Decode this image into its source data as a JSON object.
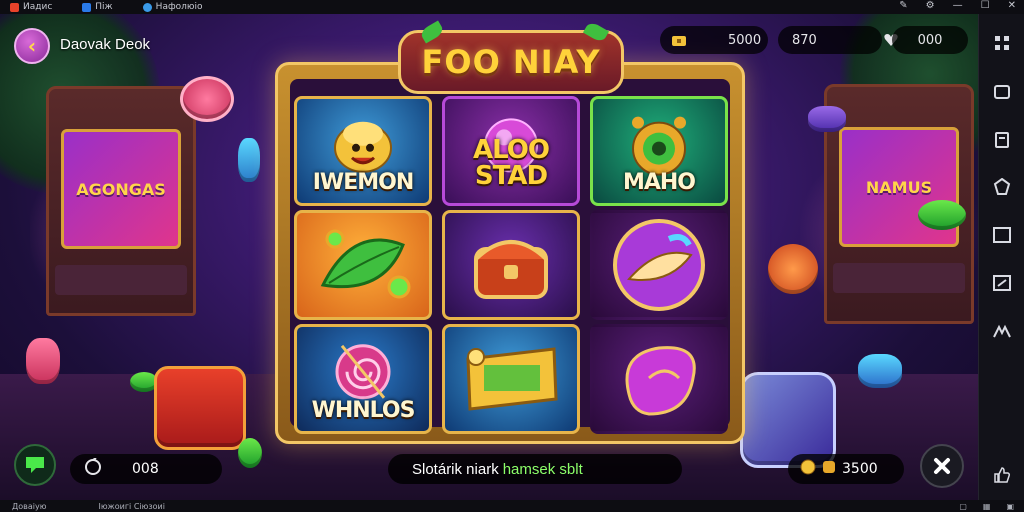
{
  "window": {
    "tabs": [
      "Иадис",
      "Піж",
      "Нафолюіо"
    ],
    "bottom_tabs": [
      "Доваіую",
      "Іюжоигі Сіюзоиі"
    ]
  },
  "hud": {
    "back_glyph": "‹",
    "left_title": "Daovak Deok",
    "gold_value": "5000",
    "gems_value": "870",
    "score_value": "000",
    "counter_value": "008",
    "coins_value": "3500"
  },
  "logo": {
    "text": "FOO NIAY"
  },
  "reels": [
    {
      "label": "IWEMON"
    },
    {
      "label": "ALOO STAD"
    },
    {
      "label": "MAHO"
    },
    {
      "label": ""
    },
    {
      "label": ""
    },
    {
      "label": ""
    },
    {
      "label": "WHNLOS"
    },
    {
      "label": ""
    },
    {
      "label": ""
    }
  ],
  "arcade": {
    "left_screen": "AGONGAS",
    "right_screen": "NAMUS"
  },
  "status": {
    "text": "Slotárik niark",
    "highlight": "hamsek sblt"
  },
  "colors": {
    "accent_gold": "#f3c766",
    "highlight_green": "#8cff6a",
    "purple_bg": "#3b1a6e"
  }
}
